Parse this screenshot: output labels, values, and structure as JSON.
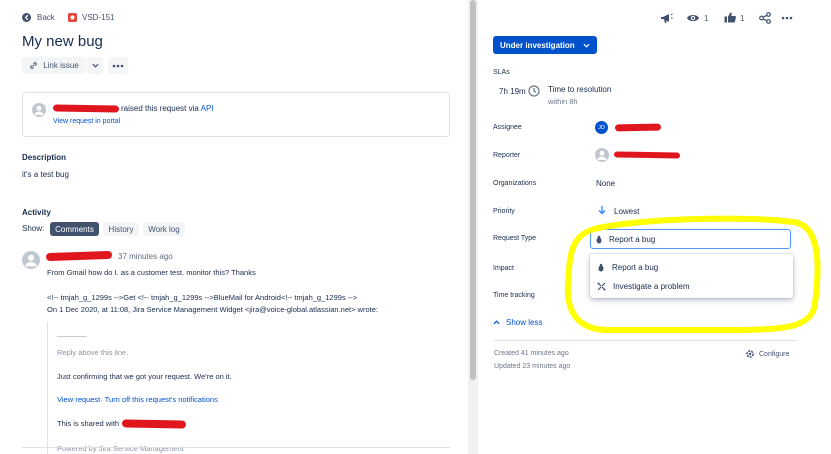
{
  "header": {
    "back_label": "Back",
    "issue_key": "VSD-151",
    "title": "My new bug",
    "link_issue_label": "Link issue"
  },
  "request": {
    "raised_text": "raised this request via",
    "via": "API",
    "view_portal": "View request in portal"
  },
  "description": {
    "heading": "Description",
    "text": "it's a test bug"
  },
  "activity": {
    "heading": "Activity",
    "show_label": "Show:",
    "tabs": [
      "Comments",
      "History",
      "Work log"
    ],
    "comment": {
      "time": "37 minutes ago",
      "line1": "From Gmail how do I. as a customer test. monitor this? Thanks",
      "line2": "<!-- tmjah_g_1299s -->Get <!-- tmjah_g_1299s -->BlueMail for Android<!-- tmjah_g_1299s -->",
      "line3": "On 1 Dec 2020, at 11:08, Jira Service Management Widget <jira@voice-global.atlassian.net> wrote:",
      "quote_rule": "__________",
      "reply_above": "Reply above this line.",
      "confirm": "Just confirming that we got your request. We're on it.",
      "view_request_link": "View request· Turn off this request's notifications",
      "shared_with": "This is shared with",
      "cutoff_text": "Powered by Jira Service Management"
    }
  },
  "topbar": {
    "watch_count": "1",
    "vote_count": "1"
  },
  "status_button": "Under investigation",
  "slas": {
    "heading": "SLAs",
    "time": "7h 19m",
    "name": "Time to resolution",
    "within": "within 8h"
  },
  "fields": {
    "assignee_label": "Assignee",
    "assignee_initials": "JD",
    "reporter_label": "Reporter",
    "organizations_label": "Organizations",
    "organizations_value": "None",
    "priority_label": "Priority",
    "priority_value": "Lowest",
    "request_type_label": "Request Type",
    "request_type_value": "Report a bug",
    "impact_label": "Impact",
    "time_tracking_label": "Time tracking"
  },
  "dropdown": {
    "options": [
      "Report a bug",
      "Investigate a problem"
    ]
  },
  "show_less": "Show less",
  "footer": {
    "created": "Created 41 minutes ago",
    "updated": "Updated 23 minutes ago",
    "configure": "Configure"
  },
  "colors": {
    "accent": "#0052cc",
    "highlight": "#ffff00",
    "redaction": "#e0161e"
  }
}
